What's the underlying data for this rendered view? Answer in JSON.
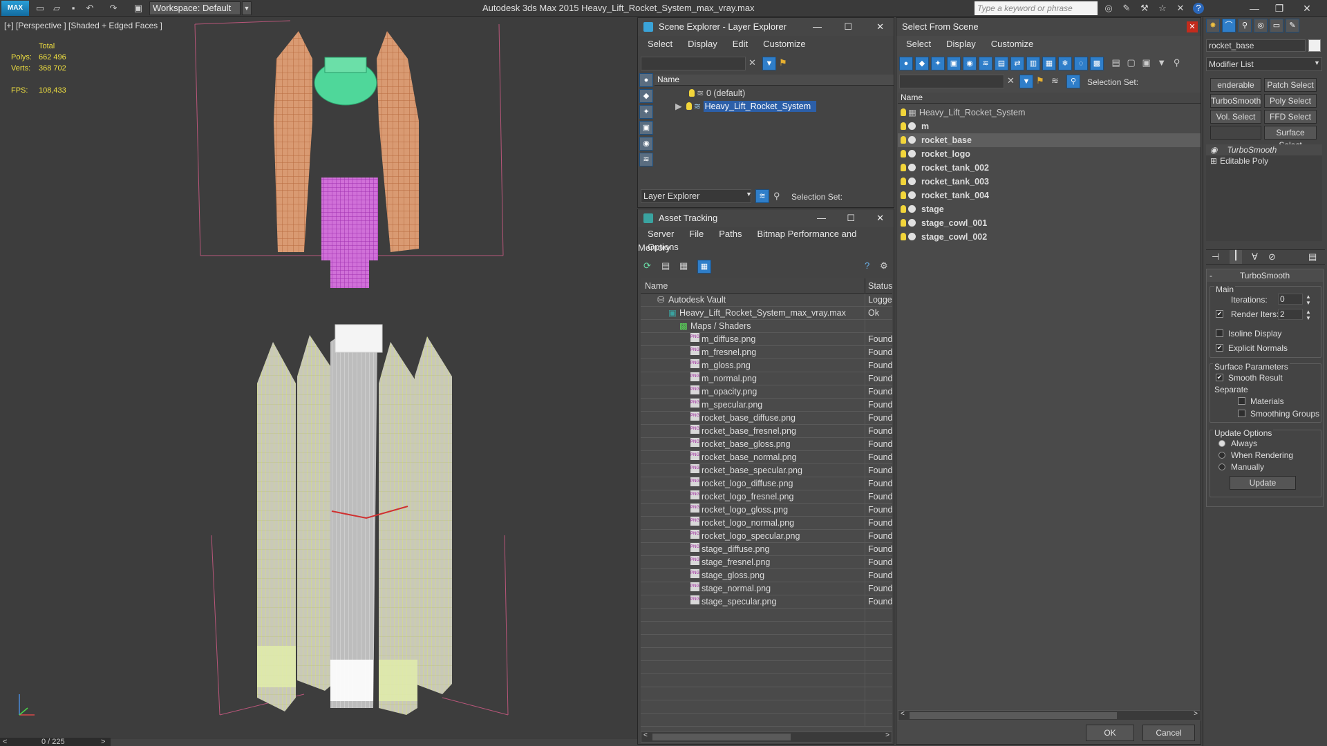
{
  "titlebar": {
    "logo": "MAX",
    "workspace": "Workspace: Default",
    "app_title": "Autodesk 3ds Max  2015    Heavy_Lift_Rocket_System_max_vray.max",
    "search_placeholder": "Type a keyword or phrase"
  },
  "viewport": {
    "label": "[+] [Perspective ] [Shaded + Edged Faces ]",
    "total_label": "Total",
    "polys_label": "Polys:",
    "polys_value": "662 496",
    "verts_label": "Verts:",
    "verts_value": "368 702",
    "fps_label": "FPS:",
    "fps_value": "108,433",
    "timeline": "0 / 225"
  },
  "scene_explorer": {
    "title": "Scene Explorer - Layer Explorer",
    "menu": [
      "Select",
      "Display",
      "Edit",
      "Customize"
    ],
    "col_name": "Name",
    "rows": [
      "0 (default)",
      "Heavy_Lift_Rocket_System"
    ],
    "footer_dropdown": "Layer Explorer",
    "selection_set": "Selection Set:"
  },
  "asset_tracking": {
    "title": "Asset Tracking",
    "menu": [
      "Server",
      "File",
      "Paths",
      "Bitmap Performance and Memory"
    ],
    "menu2": "Options",
    "col_name": "Name",
    "col_status": "Status",
    "vault": {
      "name": "Autodesk Vault",
      "status": "Logged"
    },
    "file": {
      "name": "Heavy_Lift_Rocket_System_max_vray.max",
      "status": "Ok"
    },
    "maps": "Maps / Shaders",
    "png_badge": "PNG",
    "assets": [
      {
        "name": "m_diffuse.png",
        "status": "Found"
      },
      {
        "name": "m_fresnel.png",
        "status": "Found"
      },
      {
        "name": "m_gloss.png",
        "status": "Found"
      },
      {
        "name": "m_normal.png",
        "status": "Found"
      },
      {
        "name": "m_opacity.png",
        "status": "Found"
      },
      {
        "name": "m_specular.png",
        "status": "Found"
      },
      {
        "name": "rocket_base_diffuse.png",
        "status": "Found"
      },
      {
        "name": "rocket_base_fresnel.png",
        "status": "Found"
      },
      {
        "name": "rocket_base_gloss.png",
        "status": "Found"
      },
      {
        "name": "rocket_base_normal.png",
        "status": "Found"
      },
      {
        "name": "rocket_base_specular.png",
        "status": "Found"
      },
      {
        "name": "rocket_logo_diffuse.png",
        "status": "Found"
      },
      {
        "name": "rocket_logo_fresnel.png",
        "status": "Found"
      },
      {
        "name": "rocket_logo_gloss.png",
        "status": "Found"
      },
      {
        "name": "rocket_logo_normal.png",
        "status": "Found"
      },
      {
        "name": "rocket_logo_specular.png",
        "status": "Found"
      },
      {
        "name": "stage_diffuse.png",
        "status": "Found"
      },
      {
        "name": "stage_fresnel.png",
        "status": "Found"
      },
      {
        "name": "stage_gloss.png",
        "status": "Found"
      },
      {
        "name": "stage_normal.png",
        "status": "Found"
      },
      {
        "name": "stage_specular.png",
        "status": "Found"
      }
    ]
  },
  "select_from_scene": {
    "title": "Select From Scene",
    "menu": [
      "Select",
      "Display",
      "Customize"
    ],
    "selection_set": "Selection Set:",
    "col_name": "Name",
    "root": "Heavy_Lift_Rocket_System",
    "items": [
      "m",
      "rocket_base",
      "rocket_logo",
      "rocket_tank_002",
      "rocket_tank_003",
      "rocket_tank_004",
      "stage",
      "stage_cowl_001",
      "stage_cowl_002"
    ],
    "ok": "OK",
    "cancel": "Cancel"
  },
  "command_panel": {
    "object_name": "rocket_base",
    "modifier_list": "Modifier List",
    "buttons": [
      "enderable Spli",
      "Patch Select",
      "TurboSmooth",
      "Poly Select",
      "Vol. Select",
      "FFD Select",
      "",
      "Surface Select"
    ],
    "stack": [
      "TurboSmooth",
      "Editable Poly"
    ],
    "rollout_title": "TurboSmooth",
    "main_label": "Main",
    "iterations_label": "Iterations:",
    "iterations_value": "0",
    "render_iters_label": "Render Iters:",
    "render_iters_value": "2",
    "isoline": "Isoline Display",
    "explicit_normals": "Explicit Normals",
    "surface_params": "Surface Parameters",
    "smooth_result": "Smooth Result",
    "separate": "Separate",
    "materials": "Materials",
    "smoothing_groups": "Smoothing Groups",
    "update_options": "Update Options",
    "always": "Always",
    "when_rendering": "When Rendering",
    "manually": "Manually",
    "update": "Update"
  }
}
